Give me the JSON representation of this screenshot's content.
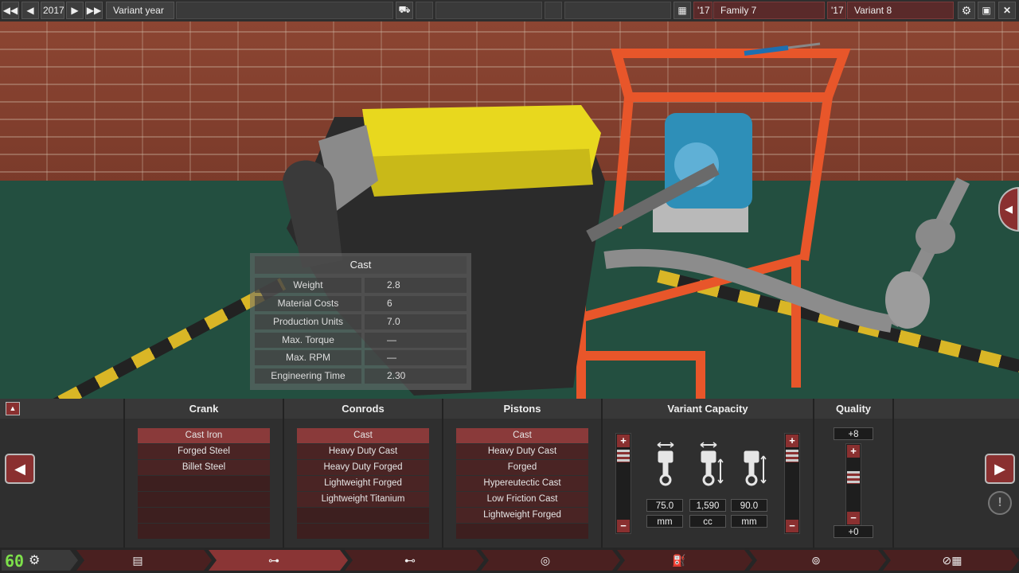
{
  "top_bar": {
    "year": "2017",
    "variant_year_label": "Variant year",
    "family_year": "'17",
    "family_name": "Family 7",
    "variant_year": "'17",
    "variant_name": "Variant 8"
  },
  "stats_panel": {
    "title": "Cast",
    "rows": [
      {
        "label": "Weight",
        "value": "2.8"
      },
      {
        "label": "Material Costs",
        "value": "6"
      },
      {
        "label": "Production Units",
        "value": "7.0"
      },
      {
        "label": "Max. Torque",
        "value": "—"
      },
      {
        "label": "Max. RPM",
        "value": "—"
      },
      {
        "label": "Engineering Time",
        "value": "2.30"
      }
    ]
  },
  "columns": {
    "crank": {
      "title": "Crank",
      "options": [
        "Cast Iron",
        "Forged Steel",
        "Billet Steel"
      ],
      "selected": "Cast Iron"
    },
    "conrods": {
      "title": "Conrods",
      "options": [
        "Cast",
        "Heavy Duty Cast",
        "Heavy Duty Forged",
        "Lightweight Forged",
        "Lightweight Titanium"
      ],
      "selected": "Cast"
    },
    "pistons": {
      "title": "Pistons",
      "options": [
        "Cast",
        "Heavy Duty Cast",
        "Forged",
        "Hypereutectic Cast",
        "Low Friction Cast",
        "Lightweight Forged"
      ],
      "selected": "Cast"
    },
    "variant_capacity": {
      "title": "Variant Capacity",
      "bore": {
        "value": "75.0",
        "unit": "mm"
      },
      "capacity": {
        "value": "1,590",
        "unit": "cc"
      },
      "stroke": {
        "value": "90.0",
        "unit": "mm"
      }
    },
    "quality": {
      "title": "Quality",
      "max": "+8",
      "current": "+0"
    }
  },
  "fps": "60",
  "icons": {
    "prev_year": "rewind-icon",
    "prev": "triangle-left-icon",
    "next": "triangle-right-icon",
    "next_year": "fast-forward-icon",
    "calendar": "calendar-icon",
    "settings": "gear-icon",
    "save": "floppy-icon",
    "close": "close-icon",
    "warning": "exclamation-icon"
  },
  "colors": {
    "accent": "#8a3a3a",
    "selected": "#8a3a3a",
    "option_bg": "#4a2424"
  }
}
